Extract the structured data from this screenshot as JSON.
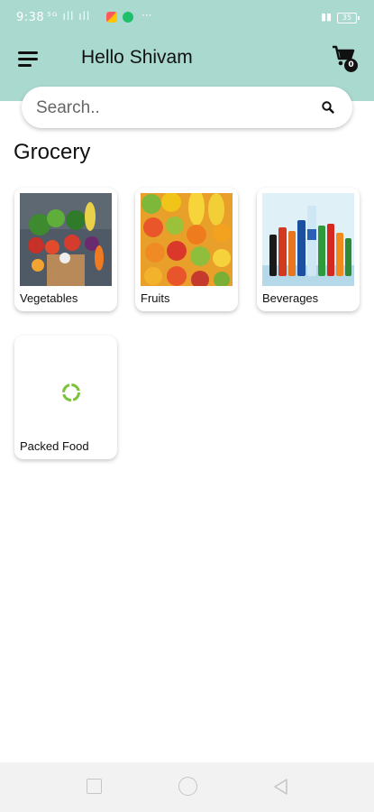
{
  "status_bar": {
    "time": "9:38",
    "signal": "⁵ᴳ ıll ıll",
    "dots": "···",
    "battery": "35"
  },
  "app_bar": {
    "title": "Hello Shivam",
    "menu_icon": "hamburger-menu-icon",
    "cart_icon": "shopping-cart-icon",
    "cart_count": "0"
  },
  "search": {
    "placeholder": "Search..",
    "icon": "search-icon"
  },
  "section": {
    "title": "Grocery"
  },
  "categories": [
    {
      "label": "Vegetables",
      "image": "vegetables-photo"
    },
    {
      "label": "Fruits",
      "image": "fruits-photo"
    },
    {
      "label": "Beverages",
      "image": "beverages-photo"
    },
    {
      "label": "Packed Food",
      "image": "loading-spinner"
    }
  ],
  "nav_bar": {
    "items": [
      "recent-apps-icon",
      "home-icon",
      "back-icon"
    ]
  },
  "colors": {
    "header": "#a9d9cf",
    "spinner": "#7cc23a"
  }
}
